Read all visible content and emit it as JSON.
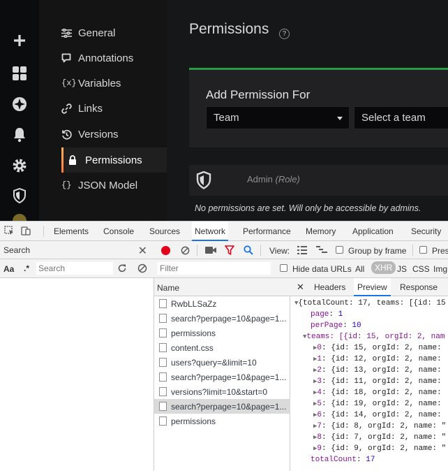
{
  "app": {
    "nav_items": [
      {
        "label": "General",
        "icon": "sliders-icon"
      },
      {
        "label": "Annotations",
        "icon": "comment-icon"
      },
      {
        "label": "Variables",
        "icon": "variable-icon"
      },
      {
        "label": "Links",
        "icon": "link-icon"
      },
      {
        "label": "Versions",
        "icon": "history-icon"
      },
      {
        "label": "Permissions",
        "icon": "lock-icon",
        "active": true
      },
      {
        "label": "JSON Model",
        "icon": "json-icon"
      }
    ],
    "page_title": "Permissions",
    "add_permission": {
      "title": "Add Permission For",
      "type_value": "Team",
      "team_placeholder": "Select a team"
    },
    "permission_row": {
      "name": "Admin",
      "role": "(Role)"
    },
    "no_permissions_text": "No permissions are set. Will only be accessible by admins.",
    "accent_color": "#299c46"
  },
  "devtools": {
    "tabs": [
      "Elements",
      "Console",
      "Sources",
      "Network",
      "Performance",
      "Memory",
      "Application",
      "Security"
    ],
    "active_tab": "Network",
    "search": {
      "title": "Search",
      "case_label": "Aa",
      "regex_label": ".*",
      "placeholder": "Search"
    },
    "network_toolbar": {
      "view_label": "View:",
      "group_by_frame": "Group by frame",
      "preserve": "Pres"
    },
    "filter": {
      "placeholder": "Filter",
      "hide_data_urls": "Hide data URLs",
      "types": [
        "All",
        "XHR",
        "JS",
        "CSS",
        "Img"
      ],
      "active_type": "XHR"
    },
    "request_list": {
      "header": "Name",
      "items": [
        "RwbLLSaZz",
        "search?perpage=10&page=1...",
        "permissions",
        "content.css",
        "users?query=&limit=10",
        "search?perpage=10&page=1...",
        "versions?limit=10&start=0",
        "search?perpage=10&page=1...",
        "permissions"
      ],
      "selected_index": 7
    },
    "preview_tabs": [
      "Headers",
      "Preview",
      "Response"
    ],
    "active_preview_tab": "Preview",
    "json_preview": {
      "root": "{totalCount: 17, teams: [{id: 15",
      "page_key": "page",
      "page_value": "1",
      "perpage_key": "perPage",
      "perpage_value": "10",
      "teams_line": "teams: [{id: 15, orgId: 2, nam",
      "team_items": [
        {
          "idx": "0",
          "text": "{id: 15, orgId: 2, name: "
        },
        {
          "idx": "1",
          "text": "{id: 12, orgId: 2, name: "
        },
        {
          "idx": "2",
          "text": "{id: 13, orgId: 2, name: "
        },
        {
          "idx": "3",
          "text": "{id: 11, orgId: 2, name: "
        },
        {
          "idx": "4",
          "text": "{id: 18, orgId: 2, name: "
        },
        {
          "idx": "5",
          "text": "{id: 19, orgId: 2, name: "
        },
        {
          "idx": "6",
          "text": "{id: 14, orgId: 2, name: "
        },
        {
          "idx": "7",
          "text": "{id: 8, orgId: 2, name: \""
        },
        {
          "idx": "8",
          "text": "{id: 7, orgId: 2, name: \""
        },
        {
          "idx": "9",
          "text": "{id: 9, orgId: 2, name: \""
        }
      ],
      "total_key": "totalCount",
      "total_value": "17"
    }
  }
}
